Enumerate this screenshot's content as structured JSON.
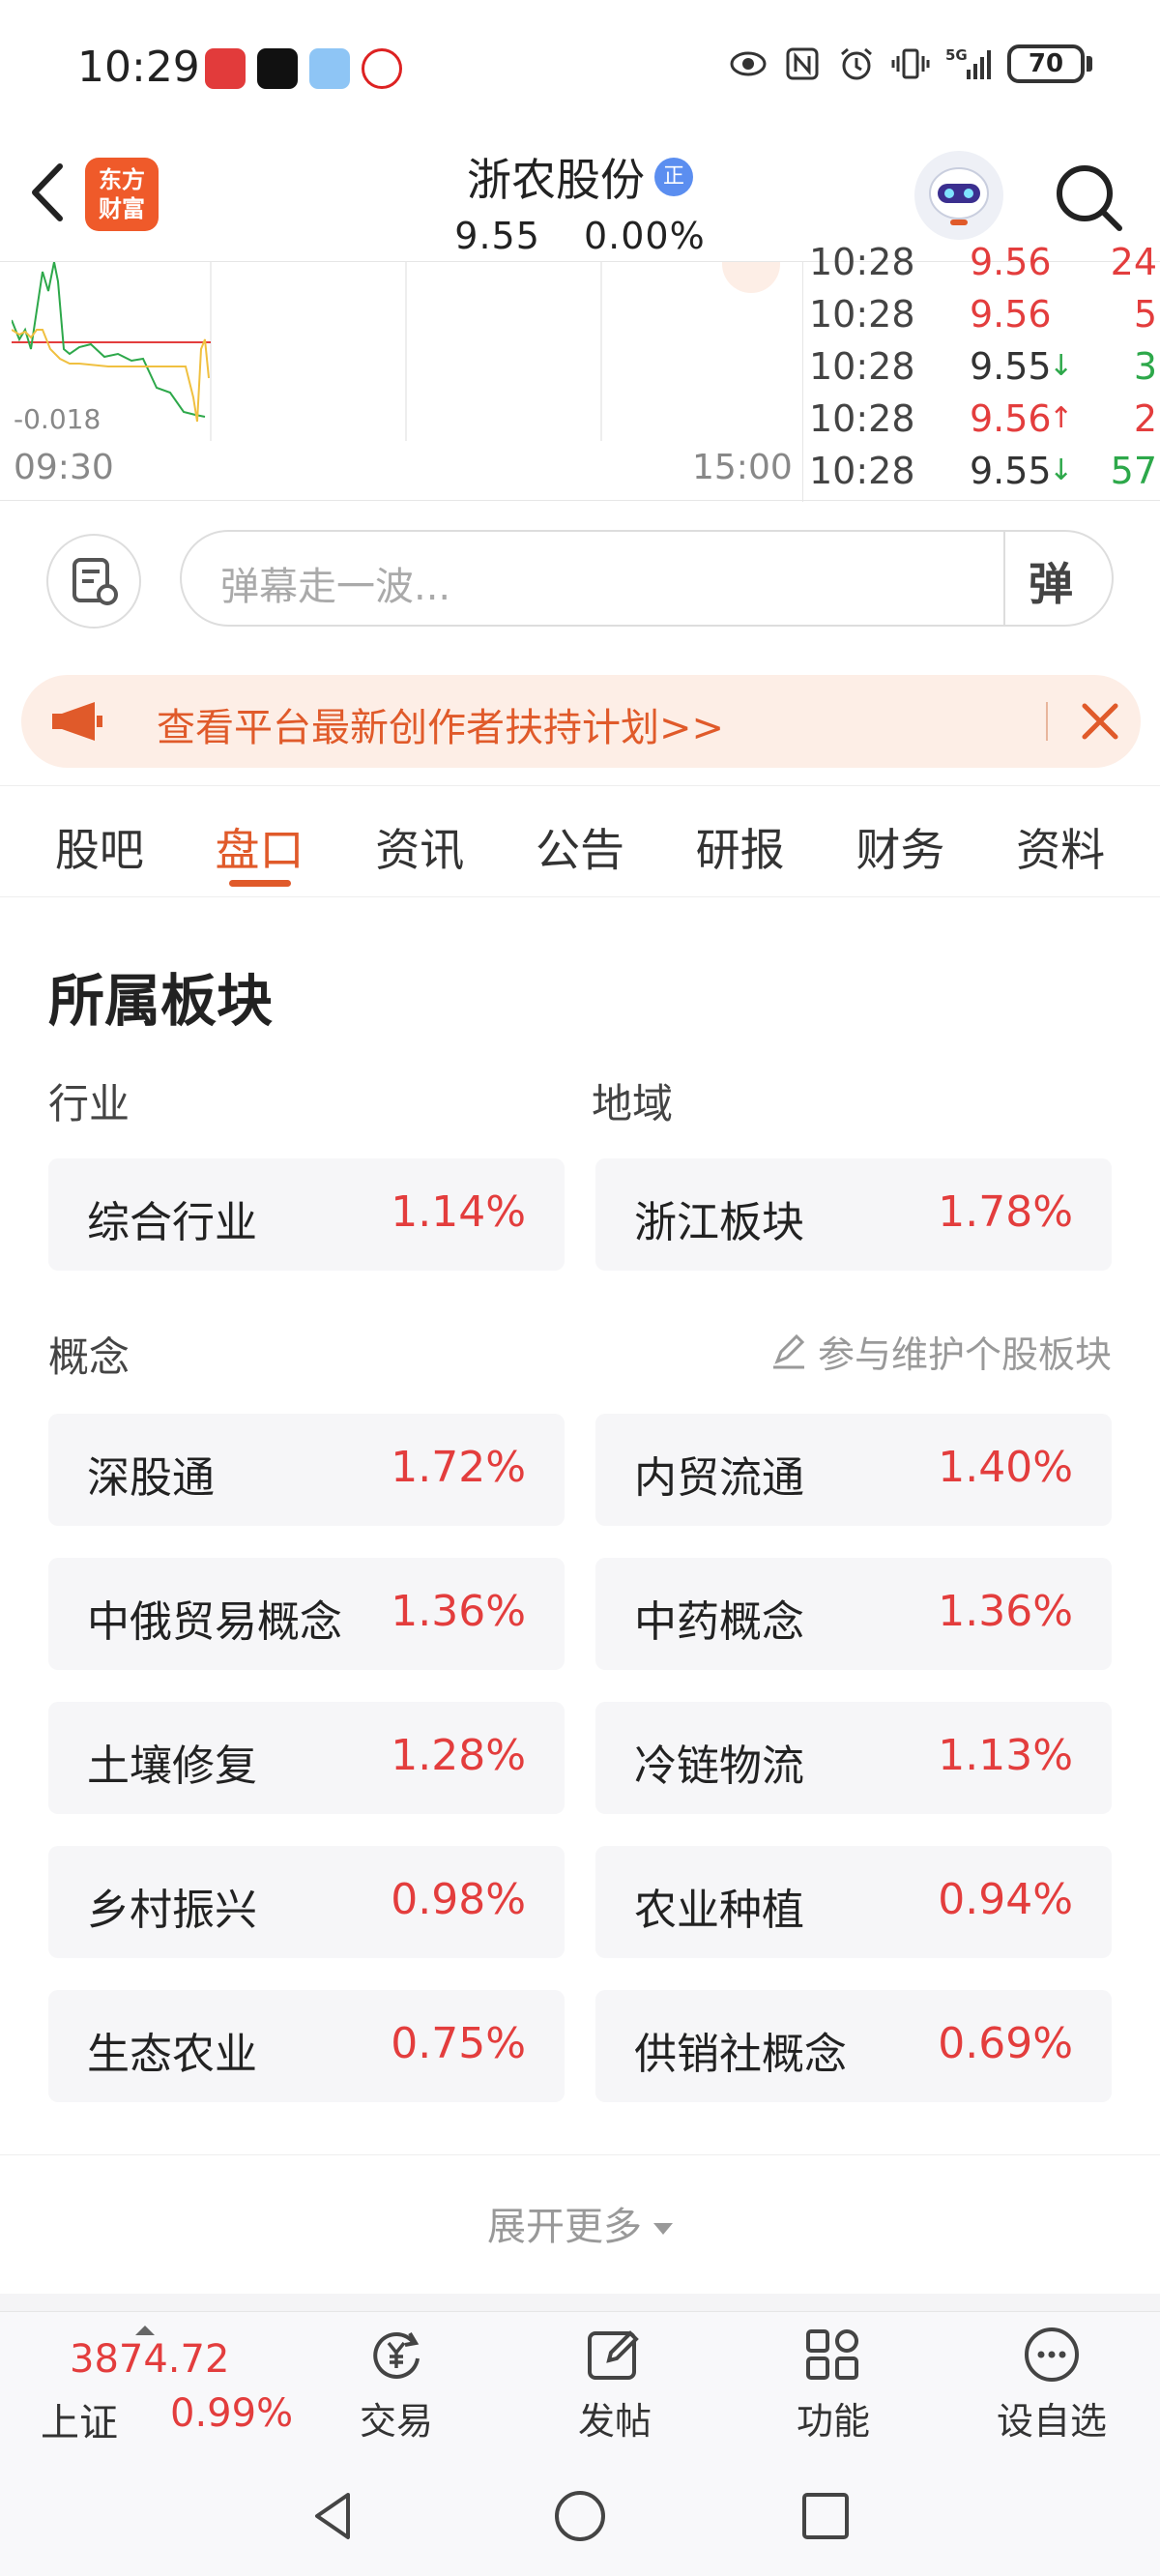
{
  "status_bar": {
    "time": "10:29",
    "battery": "70",
    "icons": [
      "eye-icon",
      "nfc-icon",
      "alarm-icon",
      "vibrate-icon",
      "signal-5g-icon"
    ]
  },
  "header": {
    "brand_line1": "东方",
    "brand_line2": "财富",
    "stock_name": "浙农股份",
    "stock_badge": "正",
    "price": "9.55",
    "change_pct": "0.00%"
  },
  "chart": {
    "low_label": "-0.018",
    "start_time": "09:30",
    "end_time": "15:00"
  },
  "ticks": [
    {
      "time": "10:28",
      "price": "9.56",
      "arrow": "",
      "volume": "24",
      "price_color": "red",
      "vol_color": "red"
    },
    {
      "time": "10:28",
      "price": "9.56",
      "arrow": "",
      "volume": "5",
      "price_color": "red",
      "vol_color": "red"
    },
    {
      "time": "10:28",
      "price": "9.55",
      "arrow": "↓",
      "volume": "3",
      "price_color": "dark",
      "vol_color": "green"
    },
    {
      "time": "10:28",
      "price": "9.56",
      "arrow": "↑",
      "volume": "2",
      "price_color": "red",
      "vol_color": "red"
    },
    {
      "time": "10:28",
      "price": "9.55",
      "arrow": "↓",
      "volume": "57",
      "price_color": "dark",
      "vol_color": "green"
    }
  ],
  "danmaku": {
    "placeholder": "弹幕走一波...",
    "send_label": "弹"
  },
  "promo": {
    "text": "查看平台最新创作者扶持计划>>"
  },
  "tabs": [
    {
      "label": "股吧",
      "active": false
    },
    {
      "label": "盘口",
      "active": true
    },
    {
      "label": "资讯",
      "active": false
    },
    {
      "label": "公告",
      "active": false
    },
    {
      "label": "研报",
      "active": false
    },
    {
      "label": "财务",
      "active": false
    },
    {
      "label": "资料",
      "active": false
    }
  ],
  "sectors": {
    "title": "所属板块",
    "industry_label": "行业",
    "region_label": "地域",
    "concept_label": "概念",
    "maintain_link": "参与维护个股板块",
    "industry": {
      "name": "综合行业",
      "pct": "1.14%"
    },
    "region": {
      "name": "浙江板块",
      "pct": "1.78%"
    },
    "concepts": [
      {
        "name": "深股通",
        "pct": "1.72%"
      },
      {
        "name": "内贸流通",
        "pct": "1.40%"
      },
      {
        "name": "中俄贸易概念",
        "pct": "1.36%"
      },
      {
        "name": "中药概念",
        "pct": "1.36%"
      },
      {
        "name": "土壤修复",
        "pct": "1.28%"
      },
      {
        "name": "冷链物流",
        "pct": "1.13%"
      },
      {
        "name": "乡村振兴",
        "pct": "0.98%"
      },
      {
        "name": "农业种植",
        "pct": "0.94%"
      },
      {
        "name": "生态农业",
        "pct": "0.75%"
      },
      {
        "name": "供销社概念",
        "pct": "0.69%"
      }
    ],
    "expand_more": "展开更多"
  },
  "bottom_bar": {
    "index_value": "3874.72",
    "index_name": "上证",
    "index_pct": "0.99%",
    "trade_label": "交易",
    "post_label": "发帖",
    "function_label": "功能",
    "watchlist_label": "设自选"
  },
  "colors": {
    "up_red": "#e33d3d",
    "down_green": "#2da84a",
    "accent_orange": "#e05a2a",
    "promo_bg": "#fdeee6"
  }
}
